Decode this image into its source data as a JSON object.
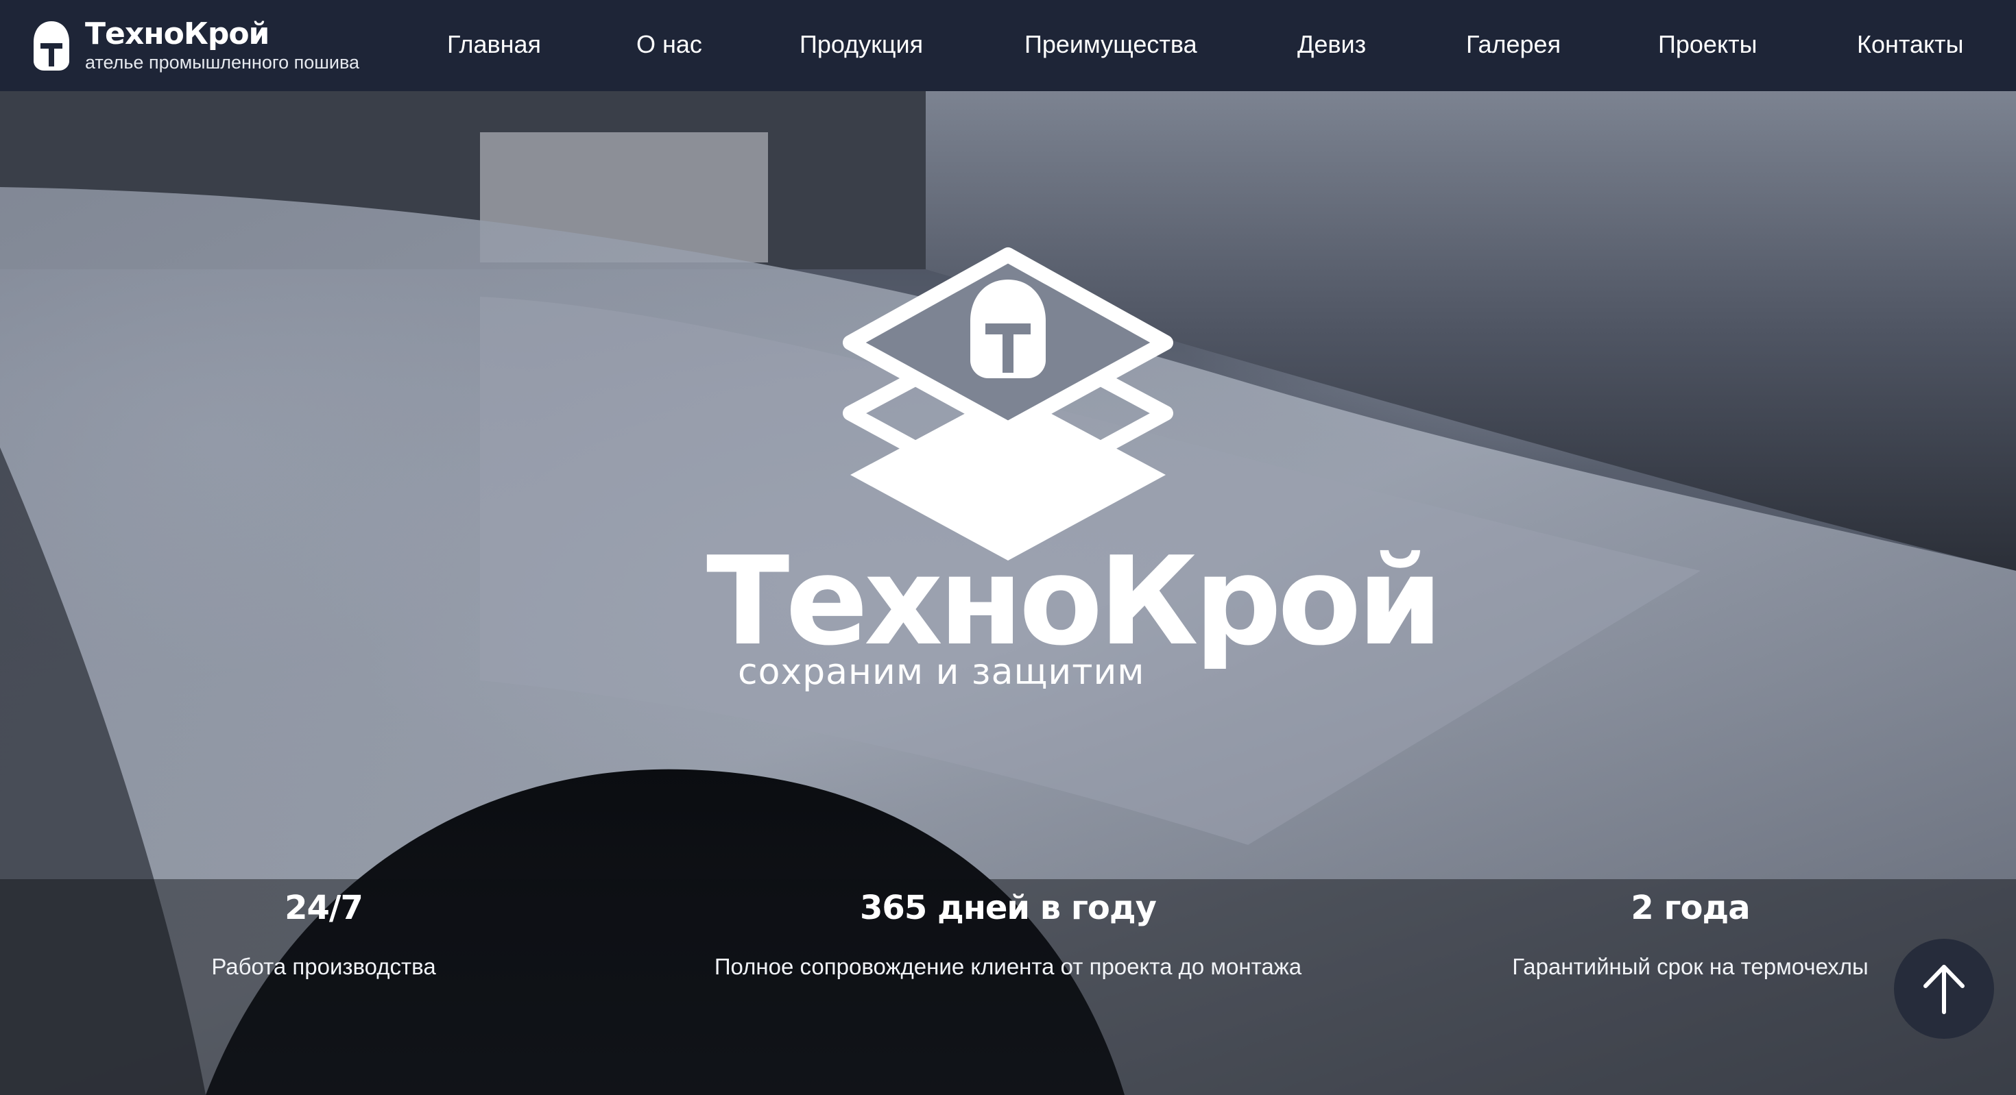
{
  "brand": {
    "name": "ТехноКрой",
    "subtitle": "ателье промышленного пошива"
  },
  "nav": {
    "items": [
      {
        "label": "Главная"
      },
      {
        "label": "О нас"
      },
      {
        "label": "Продукция"
      },
      {
        "label": "Преимущества"
      },
      {
        "label": "Девиз"
      },
      {
        "label": "Галерея"
      },
      {
        "label": "Проекты"
      },
      {
        "label": "Контакты"
      }
    ]
  },
  "hero": {
    "title": "ТехноКрой",
    "slogan": "сохраним и защитим",
    "stats": [
      {
        "value": "24/7",
        "label": "Работа производства"
      },
      {
        "value": "365 дней в году",
        "label": "Полное сопровождение клиента от проекта до монтажа"
      },
      {
        "value": "2 года",
        "label": "Гарантийный срок на термочехлы"
      }
    ]
  },
  "icons": {
    "brand": "helmet-icon",
    "center_logo": "helmet-layers-logo",
    "scroll_top": "arrow-up-icon"
  },
  "colors": {
    "header_bg": "#1e2537",
    "text": "#ffffff",
    "scroll_button_bg": "#242a3a"
  }
}
